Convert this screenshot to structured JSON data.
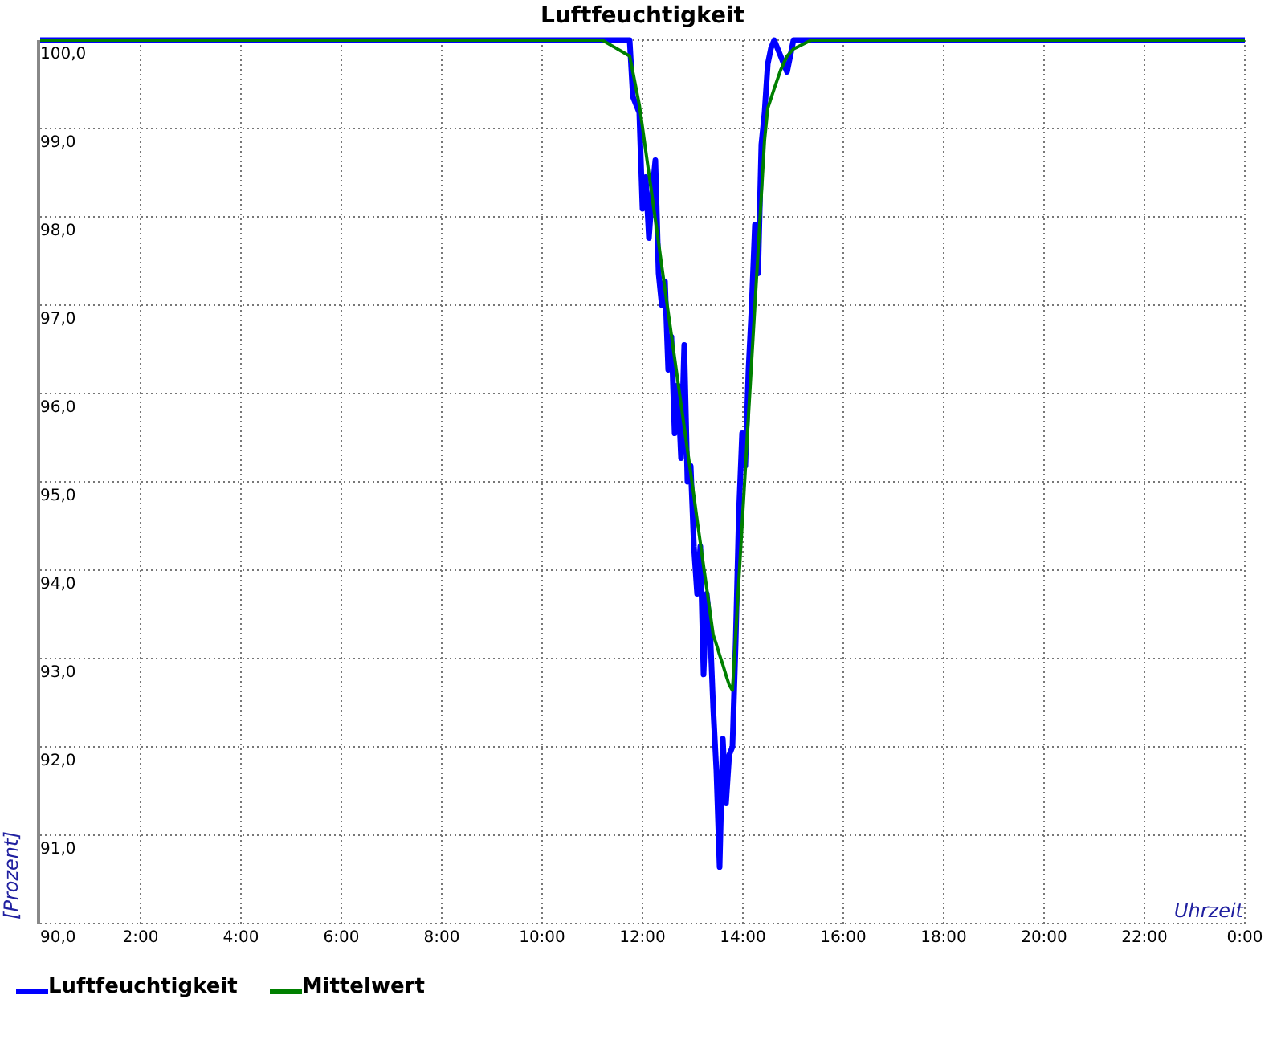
{
  "chart": {
    "chart_data": {
      "type": "line",
      "grid": true,
      "title": "Luftfeuchtigkeit",
      "xlabel": "Uhrzeit",
      "ylabel": "[Prozent]",
      "xlim": [
        0,
        24
      ],
      "ylim": [
        90,
        100
      ],
      "xticks": [
        {
          "value": 2,
          "label": "2:00"
        },
        {
          "value": 4,
          "label": "4:00"
        },
        {
          "value": 6,
          "label": "6:00"
        },
        {
          "value": 8,
          "label": "8:00"
        },
        {
          "value": 10,
          "label": "10:00"
        },
        {
          "value": 12,
          "label": "12:00"
        },
        {
          "value": 14,
          "label": "14:00"
        },
        {
          "value": 16,
          "label": "16:00"
        },
        {
          "value": 18,
          "label": "18:00"
        },
        {
          "value": 20,
          "label": "20:00"
        },
        {
          "value": 22,
          "label": "22:00"
        },
        {
          "value": 24,
          "label": "0:00"
        }
      ],
      "yticks": [
        {
          "value": 90,
          "label": "90,0"
        },
        {
          "value": 91,
          "label": "91,0"
        },
        {
          "value": 92,
          "label": "92,0"
        },
        {
          "value": 93,
          "label": "93,0"
        },
        {
          "value": 94,
          "label": "94,0"
        },
        {
          "value": 95,
          "label": "95,0"
        },
        {
          "value": 96,
          "label": "96,0"
        },
        {
          "value": 97,
          "label": "97,0"
        },
        {
          "value": 98,
          "label": "98,0"
        },
        {
          "value": 99,
          "label": "99,0"
        },
        {
          "value": 100,
          "label": "100,0"
        }
      ],
      "x": [
        0,
        11.2,
        11.68,
        11.744,
        11.808,
        11.936,
        12.0,
        12.064,
        12.128,
        12.192,
        12.256,
        12.32,
        12.384,
        12.448,
        12.512,
        12.576,
        12.64,
        12.704,
        12.768,
        12.832,
        12.896,
        12.96,
        13.024,
        13.088,
        13.152,
        13.216,
        13.28,
        13.344,
        13.408,
        13.472,
        13.536,
        13.6,
        13.664,
        13.728,
        13.792,
        13.856,
        13.92,
        13.984,
        14.048,
        14.112,
        14.176,
        14.24,
        14.304,
        14.368,
        14.432,
        14.496,
        14.56,
        14.624,
        14.752,
        14.88,
        15.008,
        15.36,
        24
      ],
      "series": [
        {
          "name": "Luftfeuchtigkeit",
          "color": "#0000ff",
          "values": [
            100,
            100,
            100,
            100,
            99.36,
            99.18,
            98.09,
            98.45,
            97.76,
            98.27,
            98.64,
            97.36,
            97.0,
            97.27,
            96.27,
            96.64,
            95.55,
            96.09,
            95.27,
            96.55,
            95.0,
            95.18,
            94.27,
            93.73,
            94.27,
            92.82,
            93.73,
            93.36,
            92.45,
            91.73,
            90.64,
            92.09,
            91.36,
            91.91,
            92.0,
            93.18,
            94.64,
            95.55,
            95.18,
            96.27,
            97.0,
            97.91,
            97.36,
            98.82,
            99.18,
            99.73,
            99.91,
            100,
            99.82,
            99.64,
            100,
            100,
            100
          ]
        },
        {
          "name": "Mittelwert",
          "color": "#008000",
          "values": [
            100,
            100,
            99.84,
            99.82,
            99.64,
            99.27,
            99.01,
            98.75,
            98.49,
            98.23,
            97.97,
            97.71,
            97.44,
            97.18,
            96.92,
            96.66,
            96.4,
            96.14,
            95.88,
            95.62,
            95.36,
            95.1,
            94.84,
            94.57,
            94.31,
            94.05,
            93.79,
            93.53,
            93.27,
            93.16,
            93.04,
            92.93,
            92.81,
            92.7,
            92.64,
            93.26,
            93.89,
            94.51,
            95.13,
            95.76,
            96.38,
            97.0,
            97.62,
            98.25,
            98.87,
            99.23,
            99.34,
            99.45,
            99.66,
            99.82,
            99.9,
            100,
            100
          ]
        }
      ]
    }
  }
}
